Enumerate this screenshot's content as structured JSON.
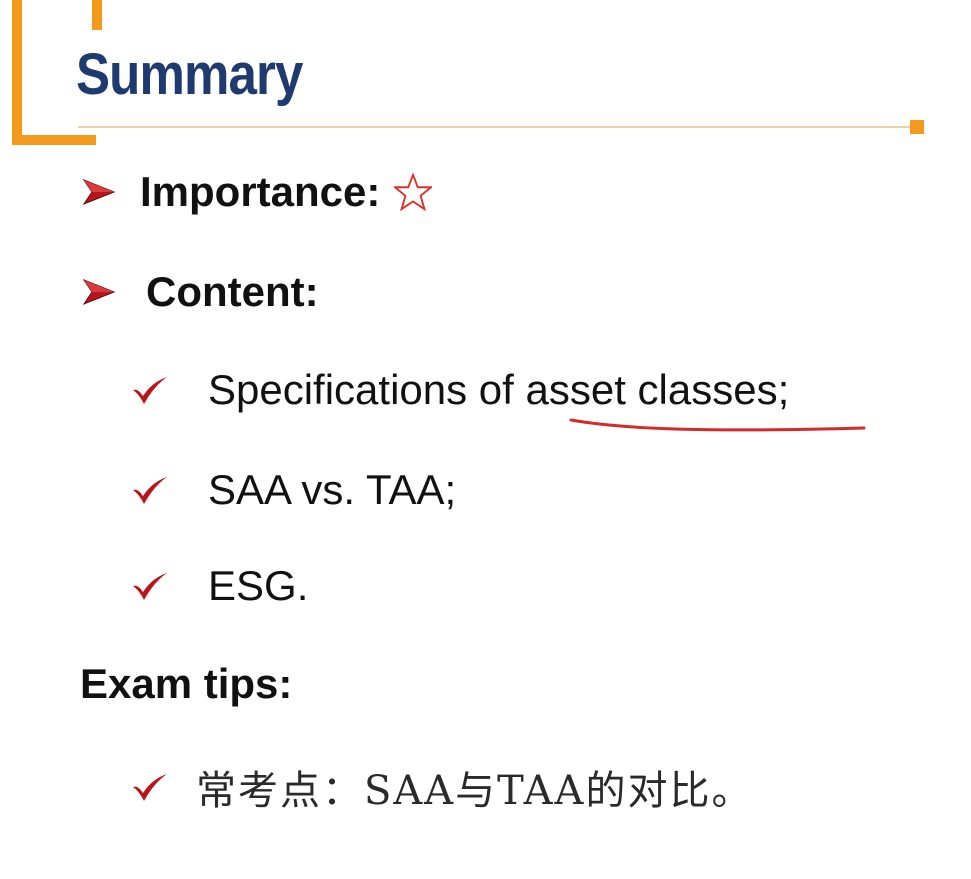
{
  "slide": {
    "title": "Summary",
    "accent_color": "#F39A1E",
    "title_color": "#1F3A6E",
    "bullet_color": "#B8161C"
  },
  "sections": {
    "importance_label": "Importance:",
    "importance_icon": "star-outline-icon",
    "content_label": "Content:"
  },
  "content_items": [
    {
      "text": "Specifications of asset classes;",
      "underlined_part": "asset classes"
    },
    {
      "text": "SAA vs. TAA;"
    },
    {
      "text": "ESG."
    }
  ],
  "exam_tips": {
    "label": "Exam tips:",
    "items": [
      {
        "text": "常考点：SAA与TAA的对比。"
      }
    ]
  }
}
